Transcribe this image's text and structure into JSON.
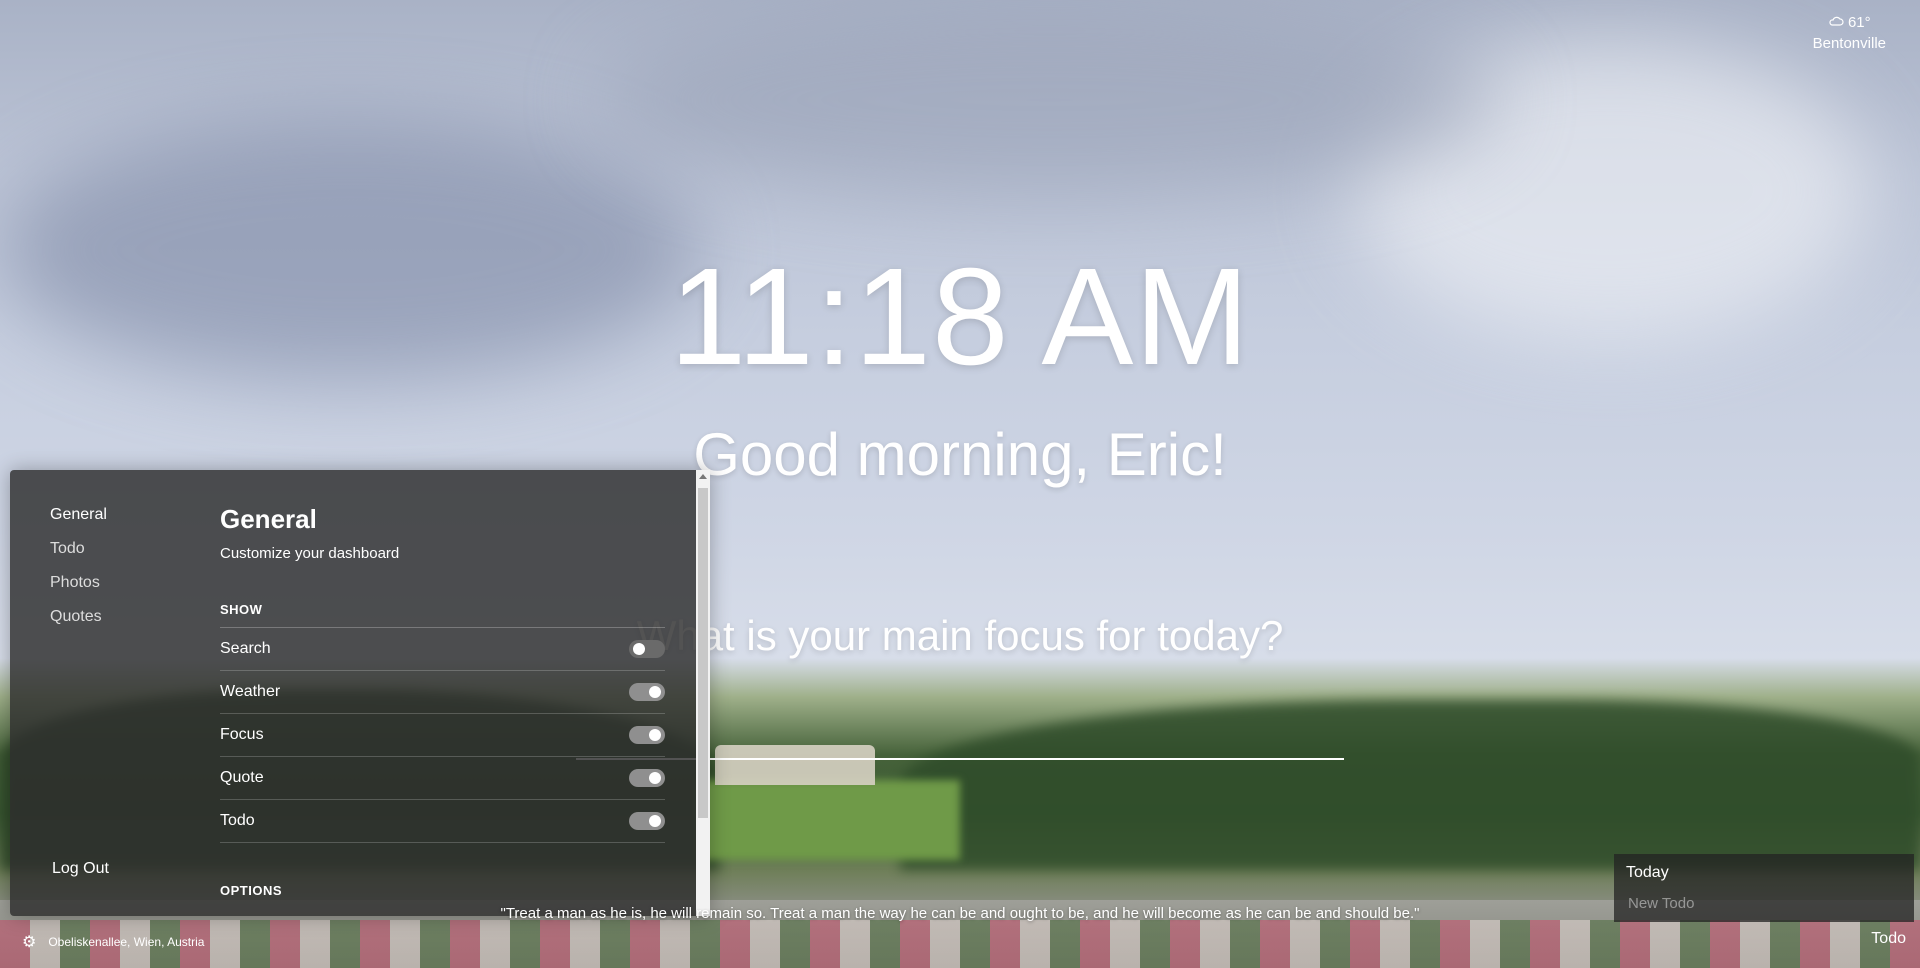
{
  "weather": {
    "icon": "cloud-sun-icon",
    "temperature": "61°",
    "city": "Bentonville"
  },
  "center": {
    "time": "11:18 AM",
    "greeting": "Good morning, Eric!",
    "focus_question": "What is your main focus for today?"
  },
  "settings": {
    "nav": [
      {
        "label": "General"
      },
      {
        "label": "Todo"
      },
      {
        "label": "Photos"
      },
      {
        "label": "Quotes"
      }
    ],
    "logout_label": "Log Out",
    "title": "General",
    "subtitle": "Customize your dashboard",
    "show_heading": "SHOW",
    "toggles": [
      {
        "label": "Search",
        "on": false
      },
      {
        "label": "Weather",
        "on": true
      },
      {
        "label": "Focus",
        "on": true
      },
      {
        "label": "Quote",
        "on": true
      },
      {
        "label": "Todo",
        "on": true
      }
    ],
    "options_heading": "OPTIONS"
  },
  "footer": {
    "settings_icon": "gear-icon",
    "location": "Obeliskenallee, Wien, Austria",
    "quote": "\"Treat a man as he is, he will remain so. Treat a man the way he can be and ought to be, and he will become as he can be and should be.\"",
    "todo_link": "Todo"
  },
  "todo": {
    "title": "Today",
    "placeholder": "New Todo"
  }
}
